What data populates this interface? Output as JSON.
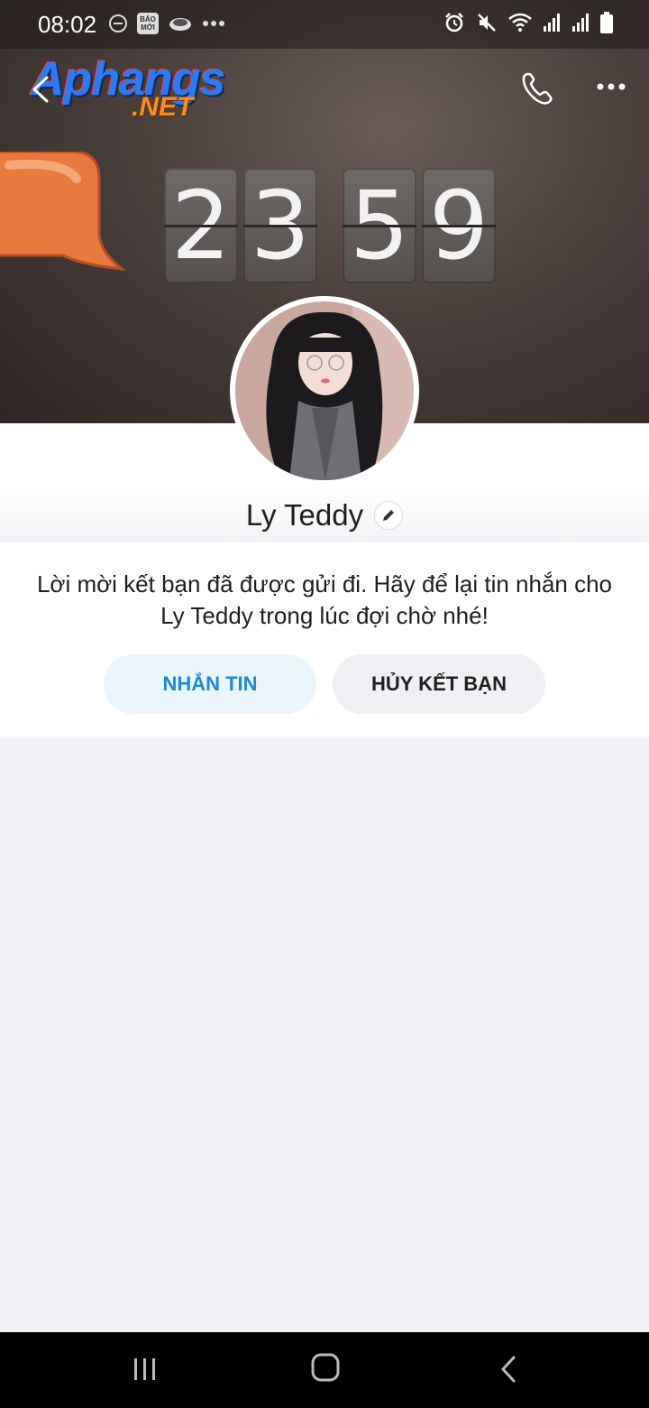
{
  "status_bar": {
    "time": "08:02",
    "left_icons": [
      "minus-circle-icon",
      "bao-moi-icon",
      "cloud-icon",
      "more-dots-icon"
    ],
    "bao_moi_label_line1": "BÁO",
    "bao_moi_label_line2": "MỚI",
    "right_icons": [
      "alarm-icon",
      "mute-icon",
      "wifi-icon",
      "signal-icon",
      "signal-icon",
      "battery-icon"
    ]
  },
  "watermark": {
    "main": "Aphangs",
    "net": ".NET"
  },
  "cover": {
    "clock_digits": [
      "2",
      "3",
      "5",
      "9"
    ]
  },
  "profile": {
    "name": "Ly Teddy"
  },
  "friend_request": {
    "message": "Lời mời kết bạn đã được gửi đi. Hãy để lại tin nhắn cho Ly Teddy trong lúc đợi chờ nhé!",
    "message_button": "NHẮN TIN",
    "cancel_button": "HỦY KẾT BẠN"
  },
  "colors": {
    "accent_blue": "#1a8ad5",
    "message_button_bg": "#eaf4fb",
    "cancel_button_bg": "#eef0f3",
    "page_bg": "#eff1f5"
  }
}
